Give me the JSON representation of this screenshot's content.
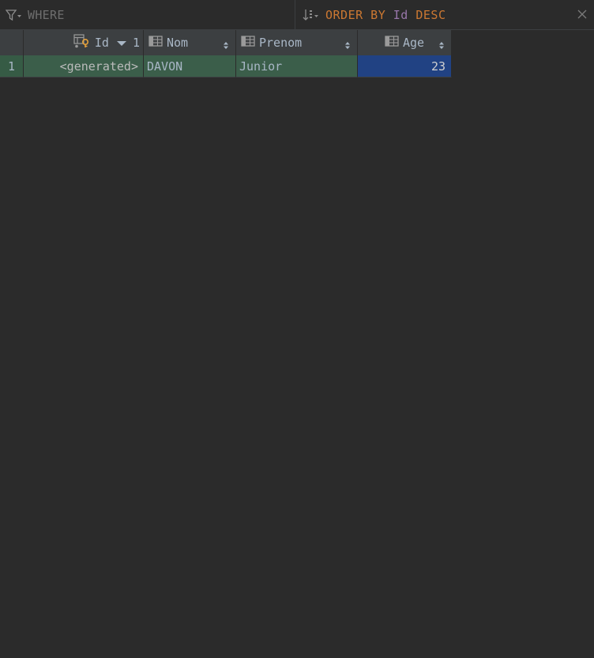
{
  "filter_bar": {
    "where_placeholder": "WHERE",
    "order_by": {
      "keyword": "ORDER BY",
      "column": "Id",
      "direction": "DESC"
    }
  },
  "table": {
    "columns": [
      {
        "name": "Id",
        "icon": "primary-key-column-icon",
        "sort": "desc",
        "sort_index": "1"
      },
      {
        "name": "Nom",
        "icon": "column-icon"
      },
      {
        "name": "Prenom",
        "icon": "column-icon"
      },
      {
        "name": "Age",
        "icon": "column-icon"
      }
    ],
    "rows": [
      {
        "row_number": "1",
        "cells": [
          "<generated>",
          "DAVON",
          "Junior",
          "23"
        ]
      }
    ]
  },
  "colors": {
    "background": "#2b2b2b",
    "header": "#3c3f41",
    "new_row": "#3b5e4a",
    "selected_cell": "#214283",
    "keyword": "#cc7832",
    "column_ref": "#9876aa"
  }
}
